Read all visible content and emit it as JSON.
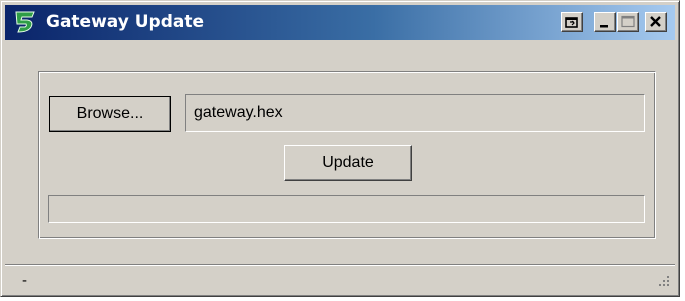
{
  "window": {
    "title": "Gateway Update",
    "icons": {
      "app": "app-logo-icon",
      "restore": "restore-icon",
      "minimize": "minimize-icon",
      "maximize": "maximize-icon",
      "close": "close-icon"
    }
  },
  "form": {
    "browse_label": "Browse...",
    "file_value": "gateway.hex",
    "update_label": "Update",
    "progress": 0
  },
  "statusbar": {
    "text": "-",
    "grip_icon": "resize-grip-icon"
  },
  "colors": {
    "titlebar_start": "#0a246a",
    "titlebar_end": "#a6caf0",
    "face": "#d4d0c8",
    "logo": "#2f9e47"
  }
}
